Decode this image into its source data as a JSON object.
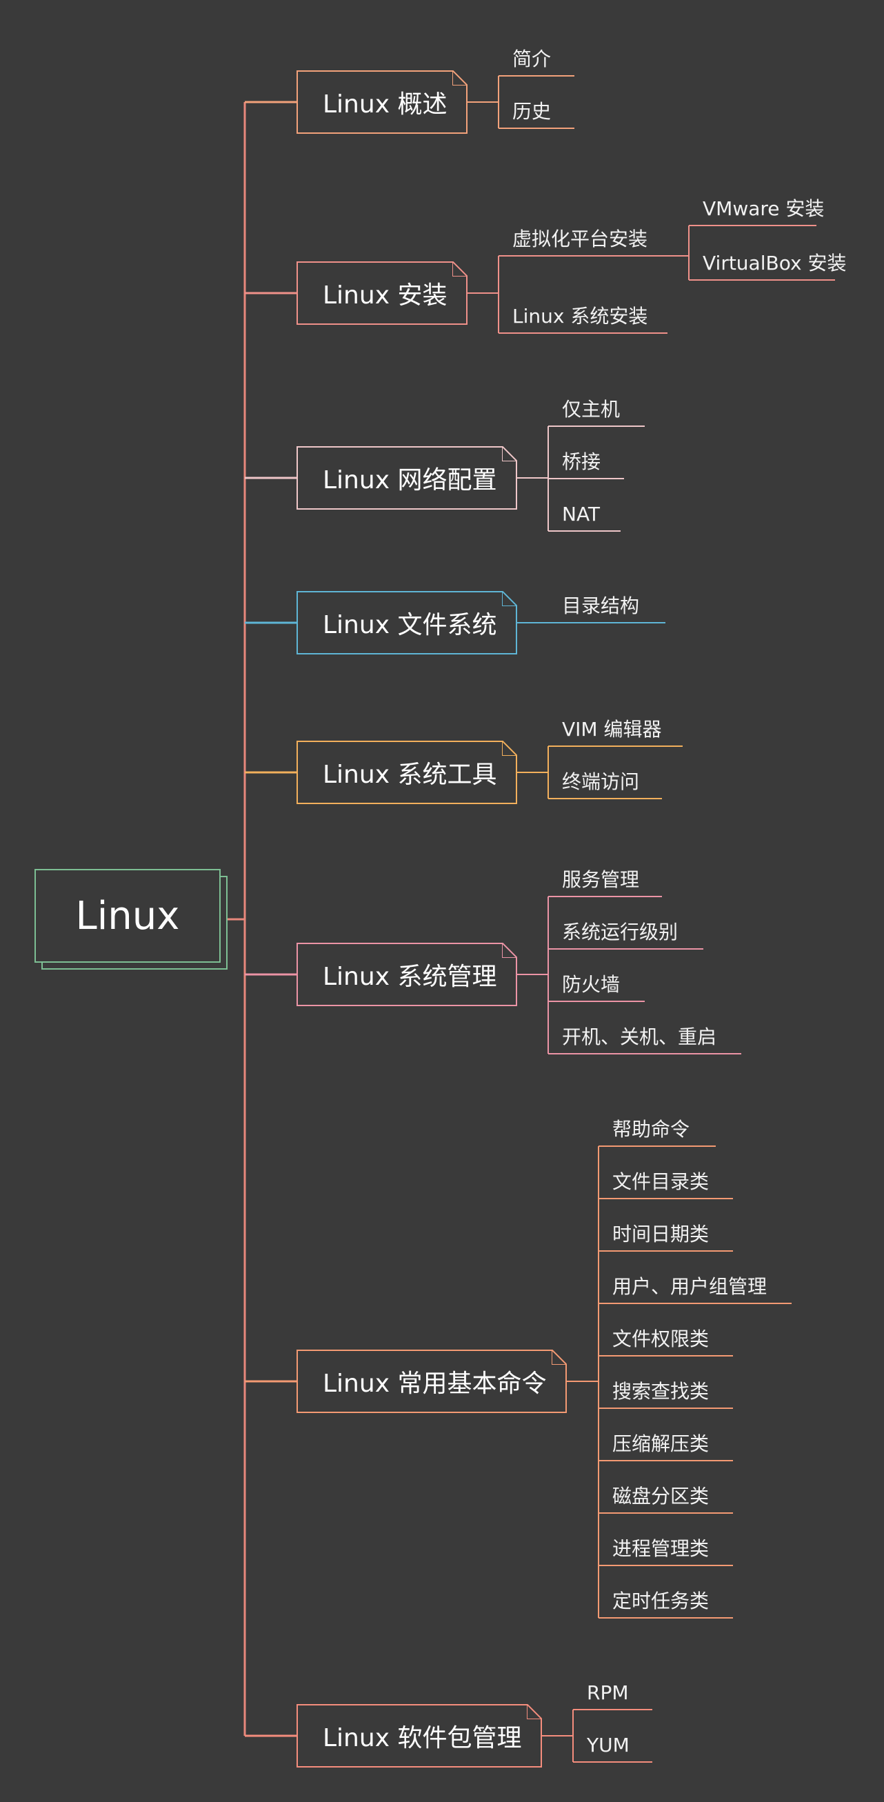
{
  "root": {
    "label": "Linux",
    "color": "#7dbf94"
  },
  "spine_color": "#e8887c",
  "branches": [
    {
      "label": "Linux 概述",
      "color": "#f3a27b",
      "children": [
        {
          "label": "简介"
        },
        {
          "label": "历史"
        }
      ]
    },
    {
      "label": "Linux 安装",
      "color": "#f0918a",
      "children": [
        {
          "label": "虚拟化平台安装",
          "children": [
            {
              "label": "VMware 安装"
            },
            {
              "label": "VirtualBox 安装"
            }
          ]
        },
        {
          "label": "Linux 系统安装"
        }
      ]
    },
    {
      "label": "Linux 网络配置",
      "color": "#efc7c9",
      "children": [
        {
          "label": "仅主机"
        },
        {
          "label": "桥接"
        },
        {
          "label": "NAT"
        }
      ]
    },
    {
      "label": "Linux 文件系统",
      "color": "#5fb6d6",
      "children": [
        {
          "label": "目录结构"
        }
      ]
    },
    {
      "label": "Linux 系统工具",
      "color": "#f3b05c",
      "children": [
        {
          "label": "VIM 编辑器"
        },
        {
          "label": "终端访问"
        }
      ]
    },
    {
      "label": "Linux 系统管理",
      "color": "#ec94a6",
      "children": [
        {
          "label": "服务管理"
        },
        {
          "label": "系统运行级别"
        },
        {
          "label": "防火墙"
        },
        {
          "label": "开机、关机、重启"
        }
      ]
    },
    {
      "label": "Linux 常用基本命令",
      "color": "#f49a73",
      "children": [
        {
          "label": "帮助命令"
        },
        {
          "label": "文件目录类"
        },
        {
          "label": "时间日期类"
        },
        {
          "label": "用户、用户组管理"
        },
        {
          "label": "文件权限类"
        },
        {
          "label": "搜索查找类"
        },
        {
          "label": "压缩解压类"
        },
        {
          "label": "磁盘分区类"
        },
        {
          "label": "进程管理类"
        },
        {
          "label": "定时任务类"
        }
      ]
    },
    {
      "label": "Linux 软件包管理",
      "color": "#f58d7d",
      "children": [
        {
          "label": "RPM"
        },
        {
          "label": "YUM"
        }
      ]
    }
  ]
}
